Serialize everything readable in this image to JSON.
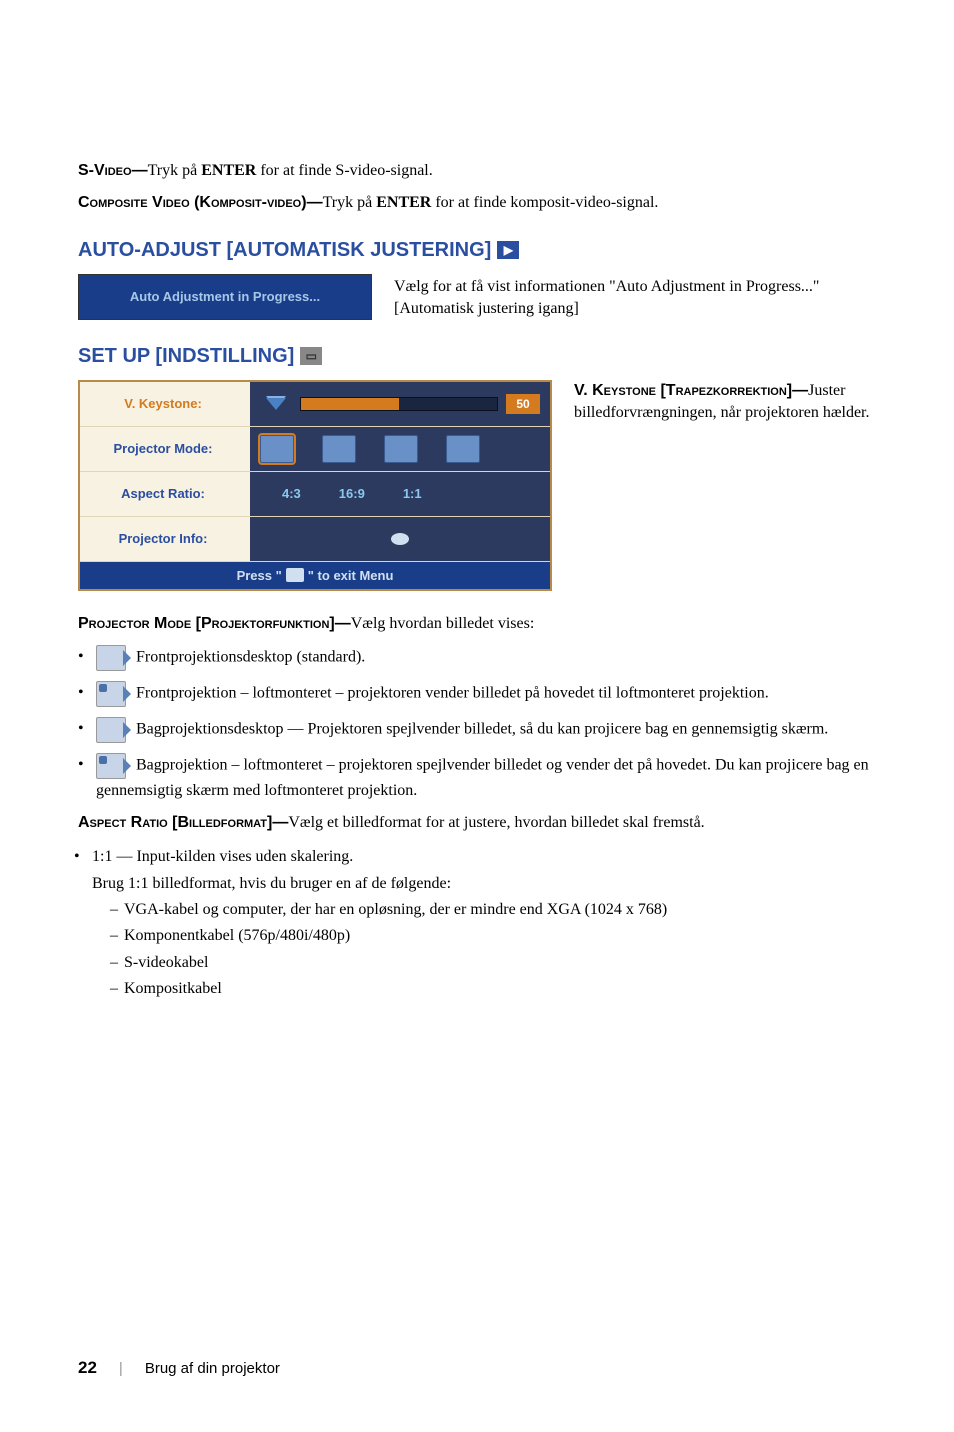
{
  "svideo": {
    "label": "S-Video—",
    "text": "Tryk på ",
    "key": "ENTER",
    "text2": " for at finde S-video-signal."
  },
  "composite": {
    "label": "Composite Video (Komposit-video)—",
    "text": "Tryk på ",
    "key": "ENTER",
    "text2": " for at finde komposit-video-signal."
  },
  "auto_adjust": {
    "heading": "AUTO-ADJUST [AUTOMATISK JUSTERING]",
    "box_text": "Auto Adjustment in Progress...",
    "desc": "Vælg for at få vist informationen \"Auto Adjustment in Progress...\" [Automatisk justering igang]"
  },
  "setup": {
    "heading": "SET UP [INDSTILLING]",
    "rows": {
      "keystone": "V. Keystone:",
      "keystone_val": "50",
      "mode": "Projector Mode:",
      "aspect": "Aspect Ratio:",
      "aspect_vals": [
        "4:3",
        "16:9",
        "1:1"
      ],
      "info": "Projector Info:",
      "footer_pre": "Press \"",
      "footer_post": "\" to exit Menu"
    },
    "side": {
      "label": "V. Keystone [Trapezkorrektion]—",
      "text": "Juster billedforvrængningen, når projektoren hælder."
    }
  },
  "projector_mode": {
    "label": "Projector Mode [Projektorfunktion]—",
    "text": "Vælg hvordan billedet vises:"
  },
  "modes": [
    "Frontprojektionsdesktop (standard).",
    "Frontprojektion – loftmonteret – projektoren vender billedet på hovedet til loftmonteret projektion.",
    "Bagprojektionsdesktop — Projektoren spejlvender billedet, så du kan projicere bag en gennemsigtig skærm.",
    "Bagprojektion – loftmonteret – projektoren spejlvender billedet og vender det på hovedet. Du kan projicere bag en gennemsigtig skærm med loftmonteret projektion."
  ],
  "aspect_ratio": {
    "label": "Aspect Ratio [Billedformat]—",
    "text": "Vælg et billedformat for at justere, hvordan billedet skal fremstå."
  },
  "one_to_one": {
    "lead": "1:1 — Input-kilden vises uden skalering.",
    "sub_intro": "Brug 1:1 billedformat, hvis du bruger en af de følgende:",
    "subs": [
      "VGA-kabel og computer, der har en opløsning, der er mindre end  XGA (1024 x 768)",
      "Komponentkabel (576p/480i/480p)",
      "S-videokabel",
      "Kompositkabel"
    ]
  },
  "footer": {
    "page": "22",
    "section": "Brug af din projektor"
  }
}
